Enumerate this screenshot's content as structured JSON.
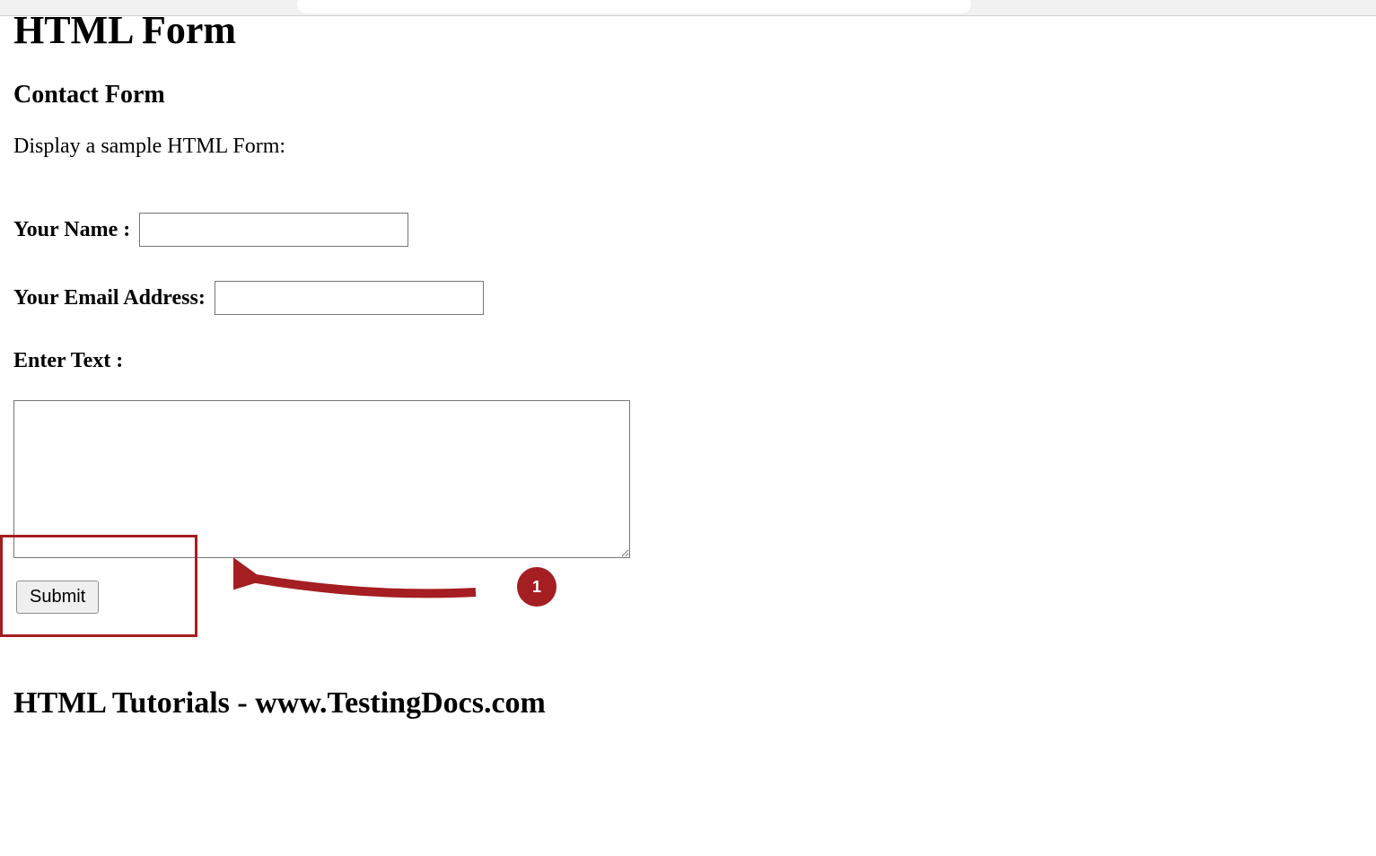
{
  "page": {
    "h1": "HTML Form",
    "h2": "Contact Form",
    "description": "Display a sample HTML Form:",
    "footer": "HTML Tutorials - www.TestingDocs.com"
  },
  "form": {
    "name_label": "Your Name :",
    "name_value": "",
    "email_label": "Your Email Address:",
    "email_value": "",
    "text_label": "Enter Text :",
    "text_value": "",
    "submit_label": "Submit"
  },
  "annotation": {
    "badge_number": "1",
    "highlight_color": "#a41e22"
  }
}
